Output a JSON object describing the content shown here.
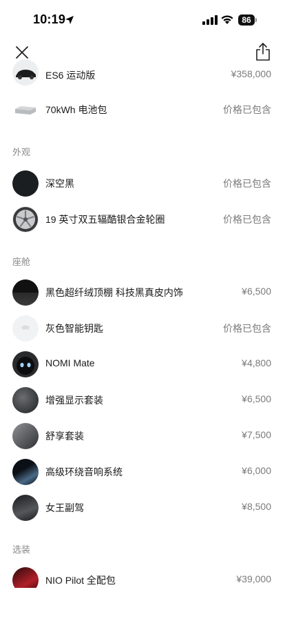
{
  "status": {
    "time": "10:19",
    "battery": "86"
  },
  "header": {
    "close_icon": "close-icon",
    "share_icon": "share-icon"
  },
  "top_items": [
    {
      "label": "ES6 运动版",
      "price": "¥358,000",
      "thumb": "car-thumbnail"
    },
    {
      "label": "70kWh 电池包",
      "price": "价格已包含",
      "thumb": "battery-pack-thumbnail"
    }
  ],
  "sections": {
    "exterior": {
      "title": "外观",
      "items": [
        {
          "label": "深空黑",
          "price": "价格已包含",
          "thumb": "color-swatch"
        },
        {
          "label": "19 英寸双五辐酷银合金轮圈",
          "price": "价格已包含",
          "thumb": "wheel-thumbnail"
        }
      ]
    },
    "cabin": {
      "title": "座舱",
      "items": [
        {
          "label": "黑色超纤绒顶棚 科技黑真皮内饰",
          "price": "¥6,500",
          "thumb": "interior-swatch"
        },
        {
          "label": "灰色智能钥匙",
          "price": "价格已包含",
          "thumb": "key-thumbnail"
        },
        {
          "label": "NOMI Mate",
          "price": "¥4,800",
          "thumb": "nomi-thumbnail"
        },
        {
          "label": "增强显示套装",
          "price": "¥6,500",
          "thumb": "display-thumbnail"
        },
        {
          "label": "舒享套装",
          "price": "¥7,500",
          "thumb": "seat-thumbnail"
        },
        {
          "label": "高级环绕音响系统",
          "price": "¥6,000",
          "thumb": "audio-thumbnail"
        },
        {
          "label": "女王副驾",
          "price": "¥8,500",
          "thumb": "passenger-seat-thumbnail"
        }
      ]
    },
    "options": {
      "title": "选装",
      "items": [
        {
          "label": "NIO Pilot 全配包",
          "price": "¥39,000",
          "thumb": "pilot-thumbnail"
        }
      ]
    }
  },
  "colors": {
    "background": "#ffffff",
    "text": "#1a1a1a",
    "muted": "#7a7a7a",
    "section": "#8a8a8a"
  }
}
